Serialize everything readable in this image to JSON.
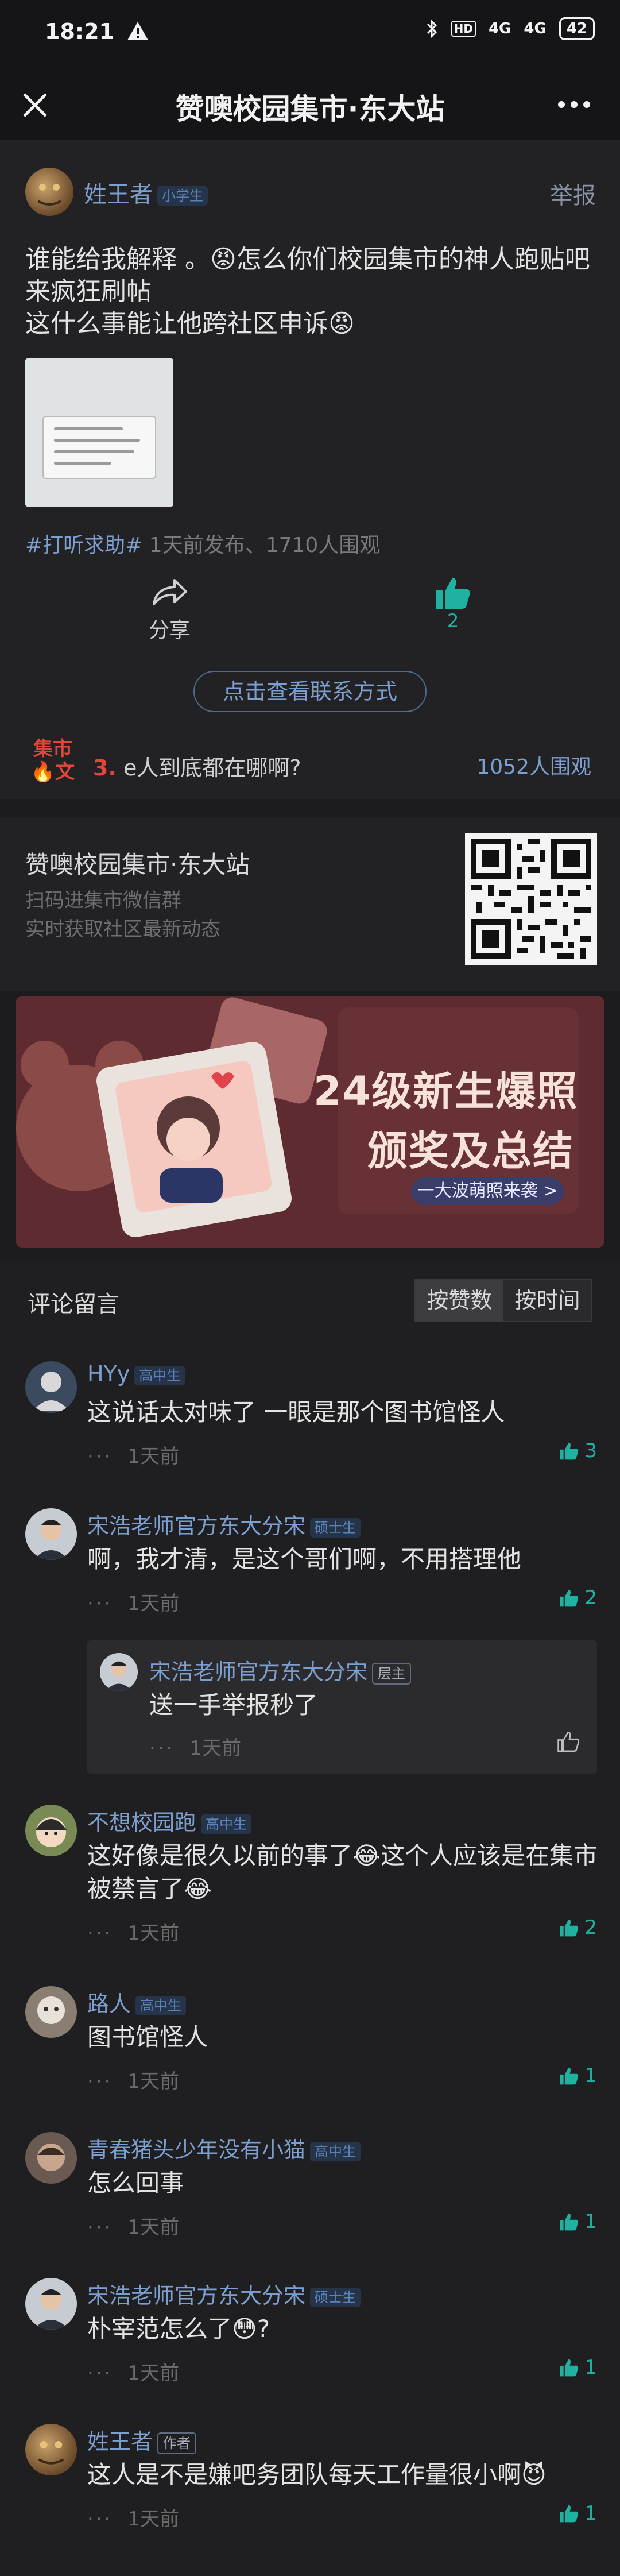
{
  "status_bar": {
    "time": "18:21",
    "battery": "42",
    "hd": "HD",
    "net1": "4G",
    "net2": "4G"
  },
  "header": {
    "title": "赞噢校园集市·东大站"
  },
  "post": {
    "author": "姓王者",
    "author_badge": "小学生",
    "report": "举报",
    "line1": "谁能给我解释 。😡怎么你们校园集市的神人跑贴吧来疯狂刷帖",
    "line2": "这什么事能让他跨社区申诉😡",
    "tag": "#打听求助#",
    "meta": "1天前发布、1710人围观",
    "share": "分享",
    "likes": "2",
    "contact_button": "点击查看联系方式"
  },
  "hot": {
    "label_top": "集市",
    "label_bottom": "🔥文",
    "rank": "3.",
    "text": "e人到底都在哪啊?",
    "views": "1052人围观"
  },
  "station": {
    "title": "赞噢校园集市·东大站",
    "sub1": "扫码进集市微信群",
    "sub2": "实时获取社区最新动态"
  },
  "banner": {
    "line1": "24级新生爆照",
    "line2": "颁奖及总结",
    "pill": "一大波萌照来袭 >"
  },
  "comments": {
    "header": "评论留言",
    "sort_options": [
      "按赞数",
      "按时间"
    ],
    "items": [
      {
        "name": "HYy",
        "badge": "高中生",
        "text": "这说话太对味了 一眼是那个图书馆怪人",
        "time": "1天前",
        "likes": "3"
      },
      {
        "name": "宋浩老师官方东大分宋",
        "badge": "硕士生",
        "text": "啊，我才清，是这个哥们啊，不用搭理他",
        "time": "1天前",
        "likes": "2",
        "reply": {
          "name": "宋浩老师官方东大分宋",
          "badge": "层主",
          "text": "送一手举报秒了",
          "time": "1天前"
        }
      },
      {
        "name": "不想校园跑",
        "badge": "高中生",
        "text": "这好像是很久以前的事了😂这个人应该是在集市被禁言了😂",
        "time": "1天前",
        "likes": "2"
      },
      {
        "name": "路人",
        "badge": "高中生",
        "text": "图书馆怪人",
        "time": "1天前",
        "likes": "1"
      },
      {
        "name": "青春猪头少年没有小猫",
        "badge": "高中生",
        "text": "怎么回事",
        "time": "1天前",
        "likes": "1"
      },
      {
        "name": "宋浩老师官方东大分宋",
        "badge": "硕士生",
        "text": "朴宰范怎么了😳?",
        "time": "1天前",
        "likes": "1"
      },
      {
        "name": "姓王者",
        "badge": "作者",
        "text": "这人是不是嫌吧务团队每天工作量很小啊😈",
        "time": "1天前",
        "likes": "1"
      }
    ]
  },
  "colors": {
    "accent": "#7d9fd0",
    "like": "#20b2a0",
    "hot": "#e2463a",
    "background": "#1c1c1e"
  }
}
